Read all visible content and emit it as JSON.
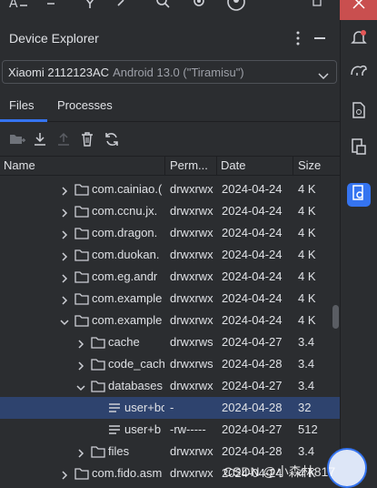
{
  "colors": {
    "background": "#2b2d30",
    "accent": "#3574f0",
    "selected_row": "#2e436e",
    "close_button": "#c94f4f"
  },
  "toolbar_icons": [
    "letters-a-icon",
    "commit-icon",
    "branch-icon",
    "arrows-icon",
    "search-icon",
    "gear-icon",
    "account-icon"
  ],
  "stripe_icons": [
    "notifications-icon",
    "gradle-elephant-icon",
    "logcat-icon",
    "device-manager-icon",
    "device-explorer-icon"
  ],
  "panel": {
    "title": "Device Explorer"
  },
  "device": {
    "name": "Xiaomi 2112123AC",
    "os": "Android 13.0 (\"Tiramisu\")"
  },
  "tabs": [
    {
      "label": "Files",
      "selected": true
    },
    {
      "label": "Processes",
      "selected": false
    }
  ],
  "columns": {
    "name": "Name",
    "permissions": "Perm...",
    "date": "Date",
    "size": "Size"
  },
  "rows": [
    {
      "name": "com.cainiao.(",
      "perm": "drwxrwx",
      "date": "2024-04-24",
      "size": "4 K",
      "depth": 0,
      "type": "folder",
      "expanded": false
    },
    {
      "name": "com.ccnu.jx.",
      "perm": "drwxrwx",
      "date": "2024-04-24",
      "size": "4 K",
      "depth": 0,
      "type": "folder",
      "expanded": false
    },
    {
      "name": "com.dragon.",
      "perm": "drwxrwx",
      "date": "2024-04-24",
      "size": "4 K",
      "depth": 0,
      "type": "folder",
      "expanded": false
    },
    {
      "name": "com.duokan.",
      "perm": "drwxrwx",
      "date": "2024-04-24",
      "size": "4 K",
      "depth": 0,
      "type": "folder",
      "expanded": false
    },
    {
      "name": "com.eg.andr",
      "perm": "drwxrwx",
      "date": "2024-04-24",
      "size": "4 K",
      "depth": 0,
      "type": "folder",
      "expanded": false
    },
    {
      "name": "com.example",
      "perm": "drwxrwx",
      "date": "2024-04-24",
      "size": "4 K",
      "depth": 0,
      "type": "folder",
      "expanded": false
    },
    {
      "name": "com.example",
      "perm": "drwxrwx",
      "date": "2024-04-24",
      "size": "4 K",
      "depth": 0,
      "type": "folder",
      "expanded": true
    },
    {
      "name": "cache",
      "perm": "drwxrws",
      "date": "2024-04-27",
      "size": "3.4",
      "depth": 1,
      "type": "folder",
      "expanded": false
    },
    {
      "name": "code_cach",
      "perm": "drwxrws",
      "date": "2024-04-28",
      "size": "3.4",
      "depth": 1,
      "type": "folder",
      "expanded": false
    },
    {
      "name": "databases",
      "perm": "drwxrwx",
      "date": "2024-04-27",
      "size": "3.4",
      "depth": 1,
      "type": "folder",
      "expanded": true
    },
    {
      "name": "user+book.db",
      "perm": "-",
      "date": "2024-04-28",
      "size": "32",
      "depth": 2,
      "type": "file",
      "selected": true
    },
    {
      "name": "user+b",
      "perm": "-rw-----",
      "date": "2024-04-27",
      "size": "512",
      "depth": 2,
      "type": "file"
    },
    {
      "name": "files",
      "perm": "drwxrwx",
      "date": "2024-04-28",
      "size": "3.4",
      "depth": 1,
      "type": "folder",
      "expanded": false
    },
    {
      "name": "com.fido.asm",
      "perm": "drwxrwx",
      "date": "2024-04-24",
      "size": "4 K",
      "depth": 0,
      "type": "folder",
      "expanded": false
    }
  ],
  "watermark": "CSDN @小森林817"
}
